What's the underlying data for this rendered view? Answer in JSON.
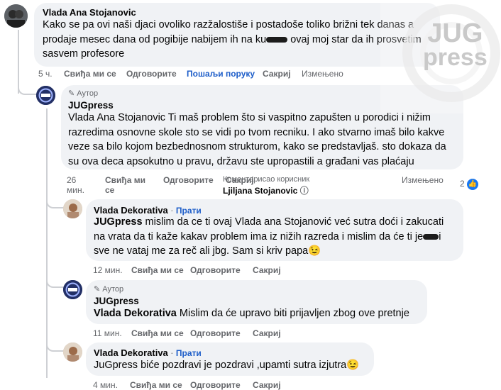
{
  "comment1": {
    "name": "Vlada Ana Stojanovic",
    "line1": "Kako se pa ovi naši djaci ovoliko razžalostiše i postadoše toliko brižni tek danas a",
    "line2a": "prodaje mesec dana od pogibije nabijem ih na ku",
    "line2b": " ovaj moj star da ih prosvetim",
    "line3": "sasvem profesore",
    "time": "5 ч.",
    "like": "Свиђа ми се",
    "reply": "Одговорите",
    "message": "Пошаљи поруку",
    "hide": "Сакриј",
    "edited": "Измењено"
  },
  "comment2": {
    "author_badge": "Аутор",
    "name": "JUGpress",
    "lines": [
      "Vlada Ana Stojanovic Ti maš problem što si vaspitno zapušten u porodici i nižim",
      "razredima osnovne skole sto se vidi po tvom recniku. I ako stvarno imaš bilo kakve",
      "veze sa bilo kojom bezbednosnom strukturom, kako se predstavljaš. sto dokaza da",
      "su ova deca apsokutno u pravu, državu ste upropastili a građani vas plaćaju"
    ],
    "time_a": "26",
    "time_b": "мин.",
    "like_a": "Свиђа ми",
    "like_b": "се",
    "reply": "Одговорите",
    "hide": "Сакриј",
    "commented_by": "Коментарисао корисник",
    "commented_user": "Ljiljana Stojanovic",
    "edited": "Измењено",
    "reactions": "2"
  },
  "comment3": {
    "name": "Vlada Dekorativa",
    "follow": "Прати",
    "mention": "JUGpress",
    "line1": " mislim da ce ti ovaj Vlada ana Stojanović već sutra doći i zakucati",
    "line2a": "na vrata da ti kaže kakav problem ima iz nižih razreda i mislim da će ti je",
    "line2b": "i",
    "line3": "sve ne vataj me za reč ali jbg. Sam si kriv papa",
    "emoji": "😉",
    "time": "12 мин.",
    "like": "Свиђа ми се",
    "reply": "Одговорите",
    "hide": "Сакриј"
  },
  "comment4": {
    "author_badge": "Аутор",
    "name": "JUGpress",
    "mention": "Vlada Dekorativa",
    "text": " Mislim da će upravo biti prijavljen zbog ove pretnje",
    "time": "11 мин.",
    "like": "Свиђа ми се",
    "reply": "Одговорите",
    "hide": "Сакриј"
  },
  "comment5": {
    "name": "Vlada Dekorativa",
    "follow": "Прати",
    "text": "JuGpress biće pozdravi je pozdravi ,upamti sutra izjutra",
    "emoji": "😉",
    "time": "4 мин.",
    "like": "Свиђа ми се",
    "reply": "Одговорите",
    "hide": "Сакриј"
  },
  "watermark": {
    "line1": "JUG",
    "line2": "press"
  }
}
